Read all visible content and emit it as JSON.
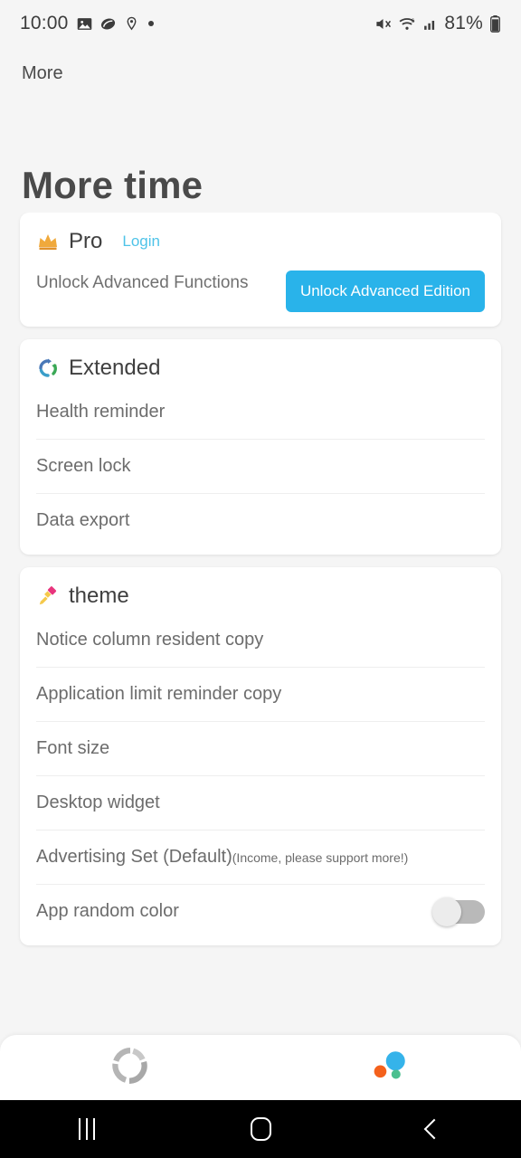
{
  "status_bar": {
    "time": "10:00",
    "battery_percent": "81%",
    "left_icons": [
      "image-icon",
      "capsule-icon",
      "location-pin-icon",
      "dot-icon"
    ],
    "right_icons": [
      "mute-icon",
      "wifi-6-icon",
      "cellular-signal-icon",
      "battery-icon"
    ]
  },
  "toolbar": {
    "title": "More"
  },
  "page": {
    "title": "More time"
  },
  "pro_card": {
    "icon": "crown-icon",
    "title": "Pro",
    "login_label": "Login",
    "description": "Unlock Advanced Functions",
    "button_label": "Unlock Advanced Edition",
    "button_color": "#29b3ea",
    "link_color": "#4ec3e8"
  },
  "extended_card": {
    "icon": "circular-arrows-icon",
    "title": "Extended",
    "rows": [
      {
        "label": "Health reminder"
      },
      {
        "label": "Screen lock"
      },
      {
        "label": "Data export"
      }
    ]
  },
  "theme_card": {
    "icon": "paintbrush-icon",
    "title": "theme",
    "rows": [
      {
        "label": "Notice column resident copy",
        "sub": ""
      },
      {
        "label": "Application limit reminder copy",
        "sub": ""
      },
      {
        "label": "Font size",
        "sub": ""
      },
      {
        "label": "Desktop widget",
        "sub": ""
      },
      {
        "label": "Advertising Set (Default)",
        "sub": "(Income, please support more!)"
      },
      {
        "label": "App random color",
        "sub": "",
        "toggle": "off"
      }
    ]
  },
  "bottom_nav": {
    "items": [
      {
        "icon": "donut-chart-icon",
        "state": "inactive"
      },
      {
        "icon": "bubble-chart-icon",
        "state": "active"
      }
    ],
    "active_colors": {
      "blue": "#35b3ea",
      "orange": "#f4611c",
      "green": "#4cbf8f"
    },
    "inactive_color": "#b0b0b0"
  },
  "android_nav": {
    "buttons": [
      "recents-button",
      "home-button",
      "back-button"
    ],
    "background": "#000000"
  }
}
